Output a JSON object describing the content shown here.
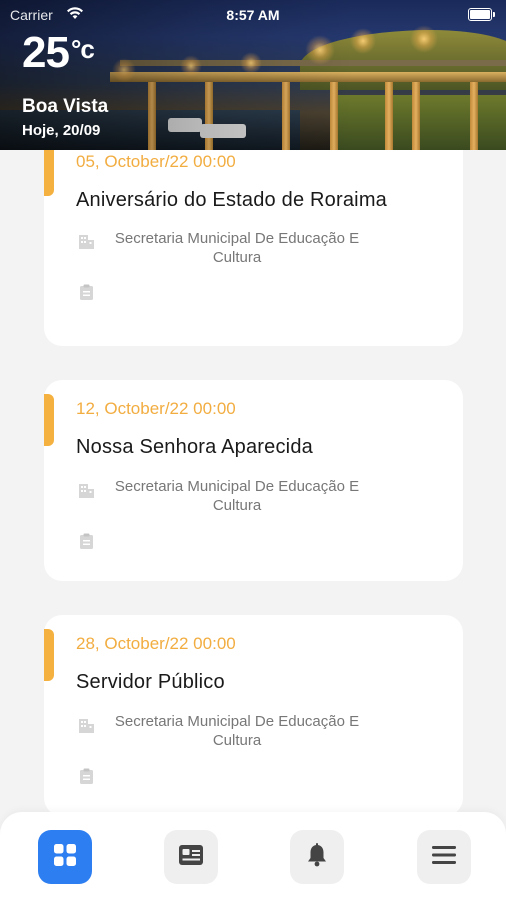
{
  "status_bar": {
    "carrier": "Carrier",
    "time": "8:57 AM"
  },
  "weather": {
    "temperature": "25",
    "unit": "°c",
    "city": "Boa Vista",
    "date": "Hoje, 20/09"
  },
  "colors": {
    "accent": "#f5b13f",
    "date_text": "#f2ad41",
    "active_tab": "#2d7ef0"
  },
  "events": [
    {
      "datetime": "05, October/22 00:00",
      "title": "Aniversário do Estado de Roraima",
      "organizer": "Secretaria Municipal De Educação E Cultura",
      "organizer_icon": "building-icon",
      "doc_icon": "clipboard-icon"
    },
    {
      "datetime": "12, October/22 00:00",
      "title": "Nossa Senhora Aparecida",
      "organizer": "Secretaria Municipal De Educação E Cultura",
      "organizer_icon": "building-icon",
      "doc_icon": "clipboard-icon"
    },
    {
      "datetime": "28, October/22 00:00",
      "title": "Servidor Público",
      "organizer": "Secretaria Municipal De Educação E Cultura",
      "organizer_icon": "building-icon",
      "doc_icon": "clipboard-icon"
    }
  ],
  "tabs": [
    {
      "icon": "grid-icon",
      "active": true
    },
    {
      "icon": "id-card-icon",
      "active": false
    },
    {
      "icon": "bell-icon",
      "active": false
    },
    {
      "icon": "menu-icon",
      "active": false
    }
  ]
}
